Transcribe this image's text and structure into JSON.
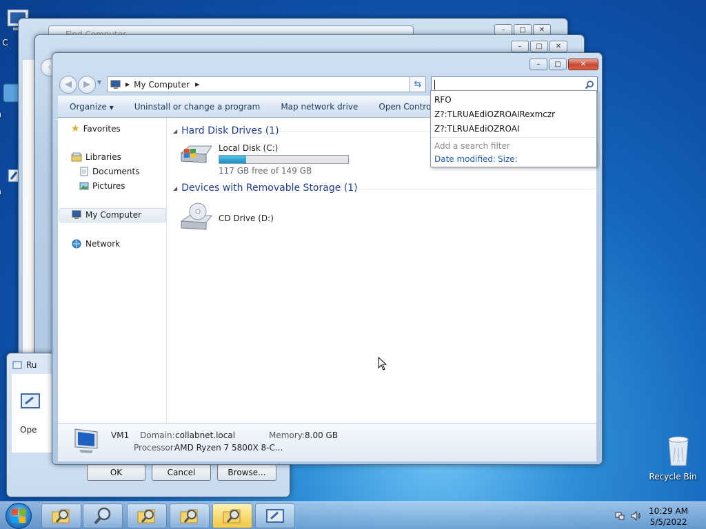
{
  "desktop": {
    "icons": [
      {
        "label": "My C"
      },
      {
        "label": "Con"
      },
      {
        "label": "Data"
      },
      {
        "label": "Recycle Bin"
      }
    ]
  },
  "background_windows": {
    "title_1": "Find Computer"
  },
  "main_window": {
    "address": {
      "location": "My Computer"
    },
    "search": {
      "value": ""
    },
    "toolbar": {
      "organize": "Organize",
      "uninstall": "Uninstall or change a program",
      "map_drive": "Map network drive",
      "control_panel": "Open Control Panel"
    },
    "nav": {
      "favorites": "Favorites",
      "libraries": "Libraries",
      "documents": "Documents",
      "pictures": "Pictures",
      "my_computer": "My Computer",
      "network": "Network"
    },
    "groups": {
      "hdd": "Hard Disk Drives (1)",
      "removable": "Devices with Removable Storage (1)"
    },
    "drives": {
      "local": {
        "name": "Local Disk (C:)",
        "free_text": "117 GB free of 149 GB",
        "used_fraction": 0.21
      },
      "cd": {
        "name": "CD Drive (D:)"
      }
    },
    "details": {
      "name": "VM1",
      "domain_label": "Domain:",
      "domain_value": "collabnet.local",
      "memory_label": "Memory:",
      "memory_value": "8.00 GB",
      "processor_label": "Processor:",
      "processor_value": "AMD Ryzen 7 5800X 8-C..."
    }
  },
  "search_dropdown": {
    "suggestions": [
      "RFO",
      "Z?:TLRUAEdiOZROAIRexmczr",
      "Z?:TLRUAEdiOZROAI"
    ],
    "filter_hint": "Add a search filter",
    "filter_date": "Date modified:",
    "filter_size": "Size:"
  },
  "run_dialog": {
    "title": "Ru",
    "open_label": "Ope",
    "ok": "OK",
    "cancel": "Cancel",
    "browse": "Browse..."
  },
  "taskbar": {
    "time": "10:29 AM",
    "date": "5/5/2022"
  },
  "colors": {
    "accent": "#1e3a8f",
    "close_button": "#c7452f",
    "progress": "#1f8ec4"
  }
}
